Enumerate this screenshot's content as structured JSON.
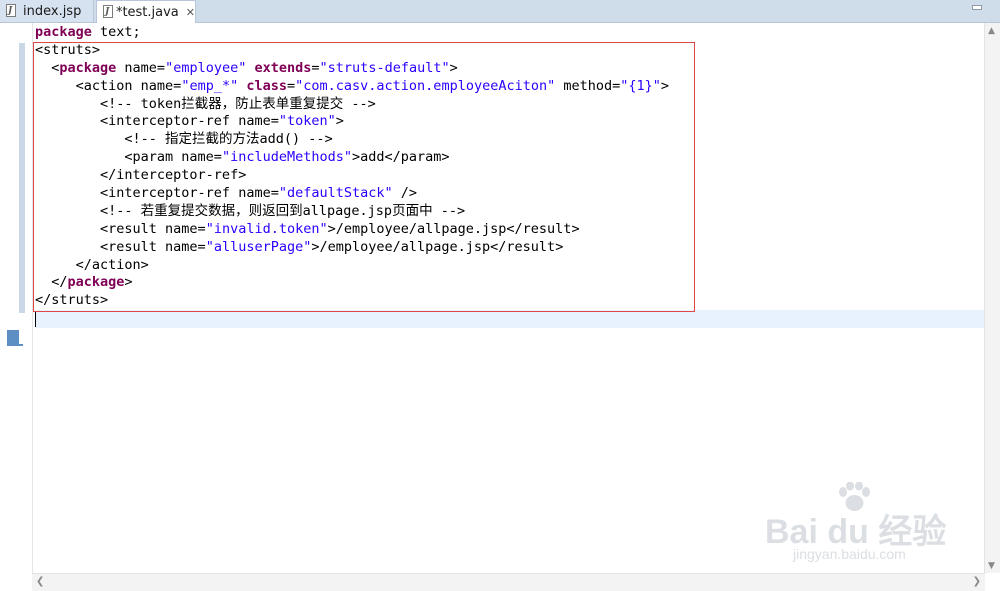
{
  "tabs": [
    {
      "label": "index.jsp",
      "icon": "jsp-file-icon",
      "active": false
    },
    {
      "label": "*test.java",
      "icon": "java-file-icon",
      "active": true,
      "close": "✕"
    }
  ],
  "editor": {
    "lines": [
      [
        {
          "t": "package",
          "c": "kw"
        },
        {
          "t": " text;",
          "c": "tag"
        }
      ],
      [
        {
          "t": "<struts>",
          "c": "tag"
        }
      ],
      [
        {
          "t": "  <",
          "c": "tag"
        },
        {
          "t": "package",
          "c": "kw"
        },
        {
          "t": " name=",
          "c": "attr"
        },
        {
          "t": "\"employee\"",
          "c": "val"
        },
        {
          "t": " ",
          "c": "tag"
        },
        {
          "t": "extends",
          "c": "kw"
        },
        {
          "t": "=",
          "c": "attr"
        },
        {
          "t": "\"struts-default\"",
          "c": "val"
        },
        {
          "t": ">",
          "c": "tag"
        }
      ],
      [
        {
          "t": "     <action name=",
          "c": "tag"
        },
        {
          "t": "\"emp_*\"",
          "c": "val"
        },
        {
          "t": " ",
          "c": "tag"
        },
        {
          "t": "class",
          "c": "kw"
        },
        {
          "t": "=",
          "c": "attr"
        },
        {
          "t": "\"com.casv.action.employeeAciton\"",
          "c": "val"
        },
        {
          "t": " method=",
          "c": "attr"
        },
        {
          "t": "\"{1}\"",
          "c": "val"
        },
        {
          "t": ">",
          "c": "tag"
        }
      ],
      [
        {
          "t": "        <!-- token拦截器，防止表单重复提交 -->",
          "c": "comment"
        }
      ],
      [
        {
          "t": "        <interceptor-ref name=",
          "c": "tag"
        },
        {
          "t": "\"token\"",
          "c": "val"
        },
        {
          "t": ">",
          "c": "tag"
        }
      ],
      [
        {
          "t": "           <!-- 指定拦截的方法add() -->",
          "c": "comment"
        }
      ],
      [
        {
          "t": "           <param name=",
          "c": "tag"
        },
        {
          "t": "\"includeMethods\"",
          "c": "val"
        },
        {
          "t": ">add</param>",
          "c": "tag"
        }
      ],
      [
        {
          "t": "        </interceptor-ref>",
          "c": "tag"
        }
      ],
      [
        {
          "t": "        <interceptor-ref name=",
          "c": "tag"
        },
        {
          "t": "\"defaultStack\"",
          "c": "val"
        },
        {
          "t": " />",
          "c": "tag"
        }
      ],
      [
        {
          "t": "        <!-- 若重复提交数据，则返回到allpage.jsp页面中 -->",
          "c": "comment"
        }
      ],
      [
        {
          "t": "        <result name=",
          "c": "tag"
        },
        {
          "t": "\"invalid.token\"",
          "c": "val"
        },
        {
          "t": ">/employee/allpage.jsp</result>",
          "c": "tag"
        }
      ],
      [
        {
          "t": "        <result name=",
          "c": "tag"
        },
        {
          "t": "\"alluserPage\"",
          "c": "val"
        },
        {
          "t": ">/employee/allpage.jsp</result>",
          "c": "tag"
        }
      ],
      [
        {
          "t": "     </action>",
          "c": "tag"
        }
      ],
      [
        {
          "t": "  </",
          "c": "tag"
        },
        {
          "t": "package",
          "c": "kw"
        },
        {
          "t": ">",
          "c": "tag"
        }
      ],
      [
        {
          "t": "</struts>",
          "c": "tag"
        }
      ],
      []
    ],
    "current_line": 17,
    "annotation_color": "#e04848"
  },
  "watermark": {
    "brand_text": "Bai du 经验",
    "url_text": "jingyan.baidu.com"
  }
}
